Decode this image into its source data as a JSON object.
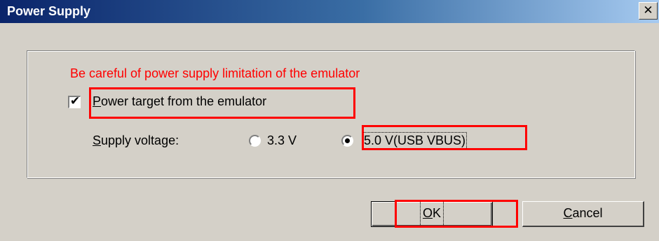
{
  "window": {
    "title": "Power Supply",
    "close_glyph": "✕"
  },
  "warning": "Be careful of power supply limitation of the emulator",
  "power_target": {
    "label_mnemonic": "P",
    "label_rest": "ower target from the emulator",
    "checked": true
  },
  "supply_voltage": {
    "label_mnemonic": "S",
    "label_rest": "upply voltage:",
    "options": [
      {
        "label": "3.3 V",
        "selected": false
      },
      {
        "label": "5.0 V(USB VBUS)",
        "selected": true
      }
    ]
  },
  "buttons": {
    "ok_mnemonic": "O",
    "ok_rest": "K",
    "cancel_mnemonic": "C",
    "cancel_rest": "ancel"
  },
  "annotation_color": "#ff0000"
}
